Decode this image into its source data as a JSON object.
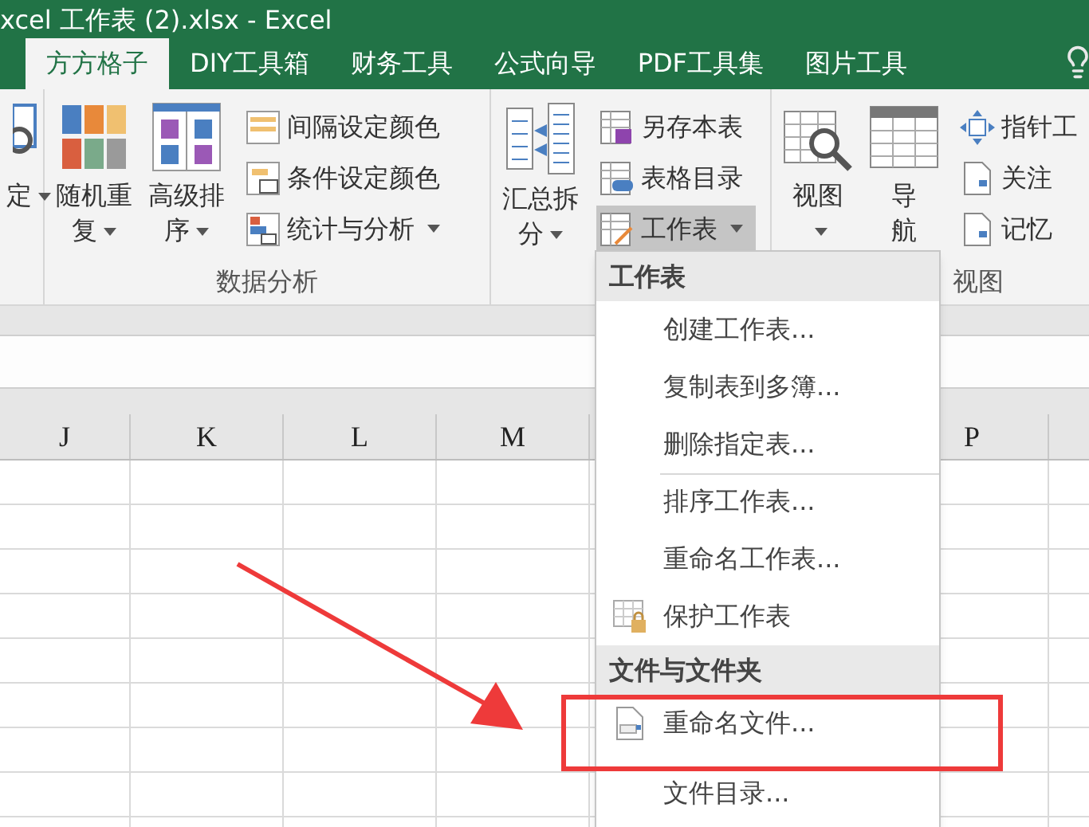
{
  "window": {
    "title": "xcel 工作表 (2).xlsx - Excel"
  },
  "tabs": [
    {
      "label": "方方格子",
      "selected": true
    },
    {
      "label": "DIY工具箱",
      "selected": false
    },
    {
      "label": "财务工具",
      "selected": false
    },
    {
      "label": "公式向导",
      "selected": false
    },
    {
      "label": "PDF工具集",
      "selected": false
    },
    {
      "label": "图片工具",
      "selected": false
    }
  ],
  "ribbon": {
    "groups": [
      {
        "large": [
          {
            "label": "定",
            "caret": true
          }
        ]
      },
      {
        "label": "数据分析",
        "large": [
          {
            "label": "随机重复",
            "caret": true
          },
          {
            "label": "高级排序",
            "caret": true
          }
        ],
        "small": [
          {
            "label": "间隔设定颜色",
            "caret": false,
            "pressed": false
          },
          {
            "label": "条件设定颜色",
            "caret": false,
            "pressed": false
          },
          {
            "label": "统计与分析",
            "caret": true,
            "pressed": false
          }
        ]
      },
      {
        "large": [
          {
            "label": "汇总拆分",
            "caret": true
          }
        ],
        "small": [
          {
            "label": "另存本表",
            "caret": false,
            "pressed": false
          },
          {
            "label": "表格目录",
            "caret": false,
            "pressed": false
          },
          {
            "label": "工作表",
            "caret": true,
            "pressed": true
          }
        ]
      },
      {
        "label": "视图",
        "large": [
          {
            "label": "视图",
            "caret": true
          },
          {
            "label": "导航",
            "caret": false
          }
        ],
        "small": [
          {
            "label": "指针工",
            "pressed": false
          },
          {
            "label": "关注",
            "pressed": false
          },
          {
            "label": "记忆",
            "pressed": false
          }
        ]
      }
    ]
  },
  "sheet": {
    "columns": [
      "J",
      "K",
      "L",
      "M",
      "P"
    ]
  },
  "menu": {
    "sections": [
      {
        "title": "工作表",
        "items": [
          {
            "label": "创建工作表...",
            "separator_before": false,
            "highlighted": false,
            "icon": false
          },
          {
            "label": "复制表到多簿...",
            "separator_before": false,
            "highlighted": false,
            "icon": false
          },
          {
            "label": "删除指定表...",
            "separator_before": false,
            "highlighted": false,
            "icon": false
          },
          {
            "label": "排序工作表...",
            "separator_before": true,
            "highlighted": false,
            "icon": false
          },
          {
            "label": "重命名工作表...",
            "separator_before": false,
            "highlighted": false,
            "icon": false
          },
          {
            "label": "保护工作表",
            "separator_before": false,
            "highlighted": false,
            "icon": true
          }
        ]
      },
      {
        "title": "文件与文件夹",
        "items": [
          {
            "label": "重命名文件...",
            "separator_before": false,
            "highlighted": true,
            "icon": true
          },
          {
            "label": "文件目录...",
            "separator_before": false,
            "highlighted": false,
            "icon": false
          }
        ]
      }
    ]
  }
}
